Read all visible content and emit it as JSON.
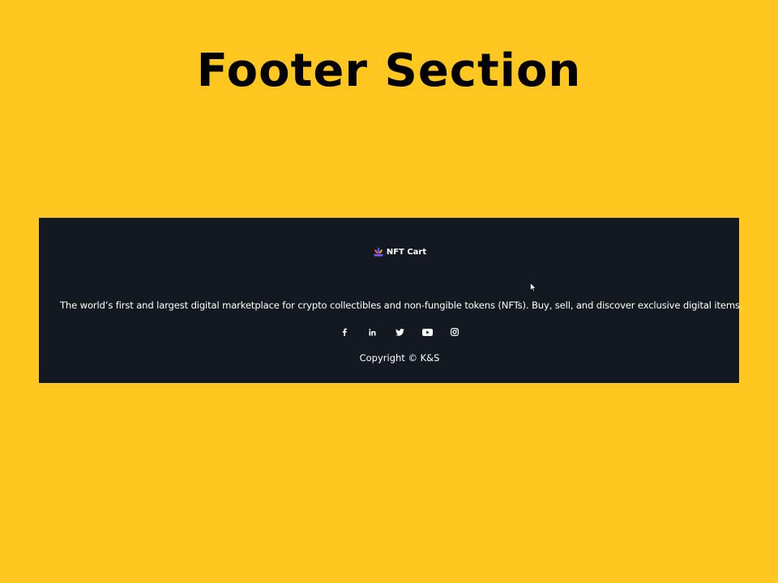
{
  "slide": {
    "title": "Footer Section",
    "background": "#FFC720"
  },
  "footer": {
    "background": "#141820",
    "brand": {
      "logo_icon": "nft-lotus-logo-icon",
      "name": "NFT Cart"
    },
    "tagline": "The world’s first and largest digital marketplace for crypto collectibles and non-fungible tokens (NFTs). Buy, sell, and discover exclusive digital items.",
    "socials": [
      {
        "icon": "facebook-icon"
      },
      {
        "icon": "linkedin-icon"
      },
      {
        "icon": "twitter-icon"
      },
      {
        "icon": "youtube-icon"
      },
      {
        "icon": "instagram-icon"
      }
    ],
    "copyright": "Copyright © K&S"
  },
  "pointer": {
    "icon": "mouse-cursor-icon"
  }
}
